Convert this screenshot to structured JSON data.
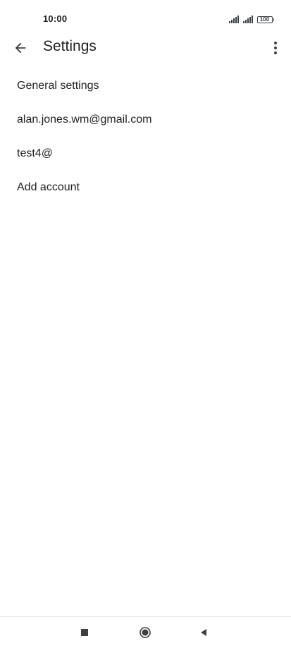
{
  "status_bar": {
    "time": "10:00",
    "battery_level": "100",
    "icons": [
      "signal-icon",
      "signal-icon",
      "battery-icon"
    ]
  },
  "app_bar": {
    "title": "Settings",
    "icons": {
      "back": "arrow-back-icon",
      "more": "more-vert-icon"
    }
  },
  "settings": {
    "items": [
      {
        "label": "General settings"
      },
      {
        "label": "alan.jones.wm@gmail.com"
      },
      {
        "label": "test4@"
      },
      {
        "label": "Add account"
      }
    ]
  },
  "nav_bar": {
    "icons": [
      "recents-square-icon",
      "home-circle-icon",
      "back-triangle-icon"
    ]
  },
  "colors": {
    "background": "#ffffff",
    "text_primary": "#202124",
    "icon": "#3c4043"
  }
}
